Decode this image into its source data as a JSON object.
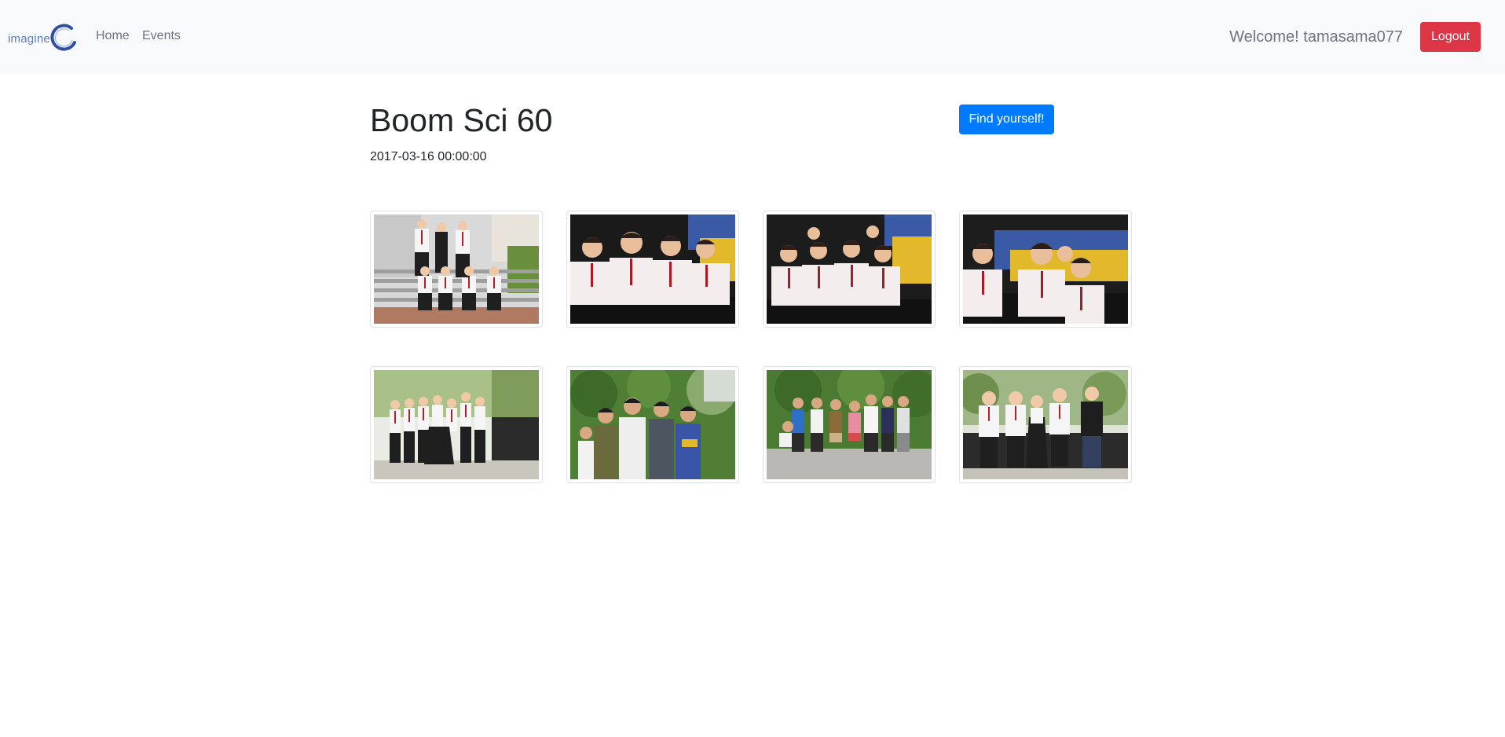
{
  "navbar": {
    "brand_text": "imagine",
    "links": [
      {
        "label": "Home"
      },
      {
        "label": "Events"
      }
    ],
    "welcome_text": "Welcome! tamasama077",
    "logout_label": "Logout"
  },
  "event": {
    "title": "Boom Sci 60",
    "date": "2017-03-16 00:00:00",
    "find_button_label": "Find yourself!"
  },
  "photos": [
    {
      "scene": "group-on-steps-outdoor"
    },
    {
      "scene": "group-seated-stadium"
    },
    {
      "scene": "group-seated-stadium"
    },
    {
      "scene": "group-seated-stadium"
    },
    {
      "scene": "group-standing-by-car"
    },
    {
      "scene": "casual-group-greenery"
    },
    {
      "scene": "casual-group-courtyard"
    },
    {
      "scene": "group-standing-by-car"
    }
  ],
  "colors": {
    "navbar_bg": "#f8f9fa",
    "logout_bg": "#dc3545",
    "find_bg": "#007bff",
    "brand_ring": "#2e4fa3"
  }
}
